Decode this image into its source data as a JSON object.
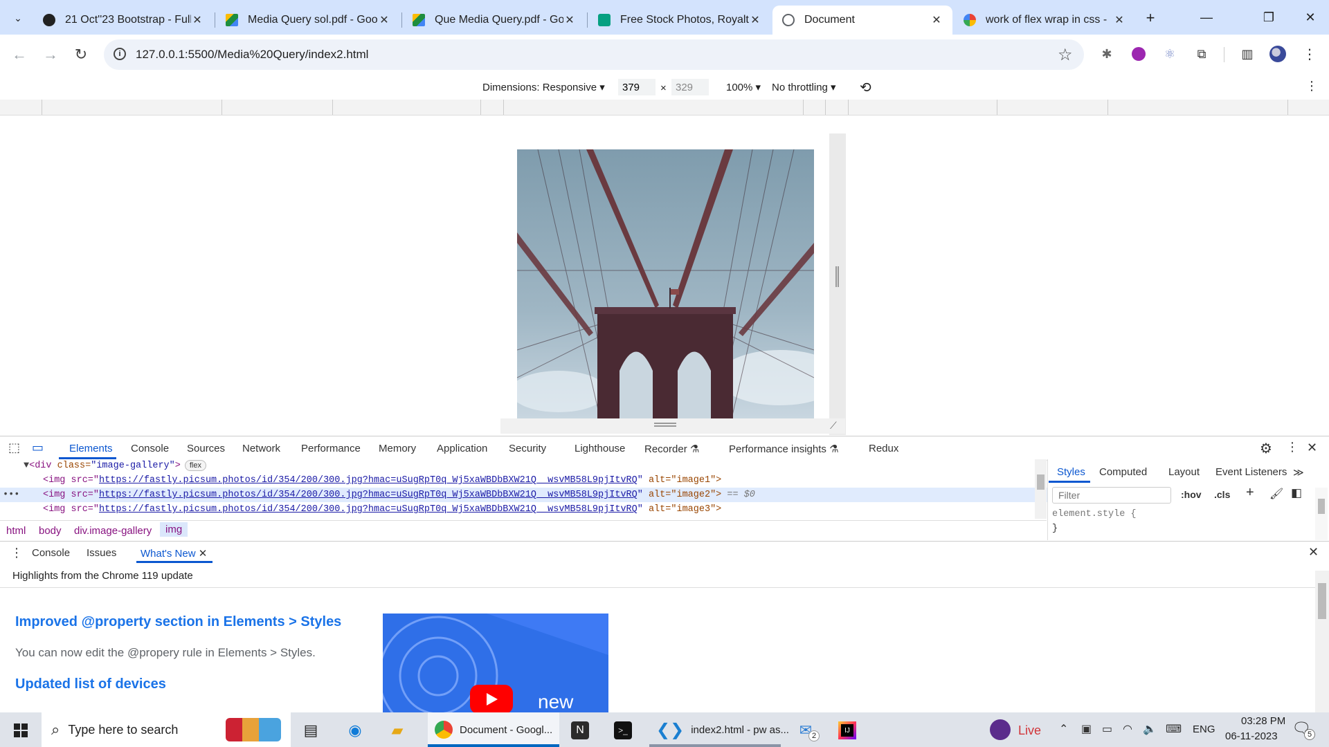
{
  "browser": {
    "tabs": [
      {
        "title": "21 Oct''23 Bootstrap - Full",
        "icon": "github-icon",
        "color": "#222222"
      },
      {
        "title": "Media Query sol.pdf - Goo",
        "icon": "google-drive-icon",
        "color": "#1e8e3e"
      },
      {
        "title": "Que Media Query.pdf - Go",
        "icon": "google-drive-icon",
        "color": "#1e8e3e"
      },
      {
        "title": "Free Stock Photos, Royalty",
        "icon": "pexels-icon",
        "color": "#05a081"
      },
      {
        "title": "Document",
        "icon": "globe-icon",
        "color": "#5f6368",
        "active": true
      },
      {
        "title": "work of flex wrap in css -",
        "icon": "google-icon",
        "color": "#4285f4"
      }
    ],
    "new_tab": "+",
    "url": "127.0.0.1:5500/Media%20Query/index2.html"
  },
  "device_toolbar": {
    "dimensions_label": "Dimensions: Responsive",
    "width": "379",
    "times": "×",
    "height": "329",
    "zoom": "100%",
    "throttling": "No throttling"
  },
  "devtools": {
    "tabs": [
      "Elements",
      "Console",
      "Sources",
      "Network",
      "Performance",
      "Memory",
      "Application",
      "Security",
      "Lighthouse",
      "Recorder",
      "Performance insights",
      "Redux"
    ],
    "dom": {
      "parent_tag_open": "<div",
      "parent_attr": "class=",
      "parent_val": "\"image-gallery\"",
      "parent_close": ">",
      "flex_badge": "flex",
      "img_prefix": "<img src=\"",
      "img_src": "https://fastly.picsum.photos/id/354/200/300.jpg?hmac=uSugRpT0q_Wj5xaWBDbBXW21Q__wsvMB58L9pjItvRQ",
      "lines": [
        {
          "alt": " alt=\"image1\">"
        },
        {
          "alt": " alt=\"image2\">",
          "suffix": " == $0"
        },
        {
          "alt": " alt=\"image3\">"
        }
      ],
      "ellipsis": "•••"
    },
    "breadcrumbs": [
      "html",
      "body",
      "div.image-gallery",
      "img"
    ],
    "styles_tabs": [
      "Styles",
      "Computed",
      "Layout",
      "Event Listeners",
      "≫"
    ],
    "filter_placeholder": "Filter",
    "hov": ":hov",
    "cls": ".cls",
    "element_style": "element.style {",
    "close_brace": "}",
    "drawer_tabs": [
      "Console",
      "Issues",
      "What's New"
    ],
    "whats_new_header": "Highlights from the Chrome 119 update",
    "whats_new": {
      "heading1": "Improved @property section in Elements > Styles",
      "text1": "You can now edit the @propery rule in Elements > Styles.",
      "heading2": "Updated list of devices",
      "video_label": "new"
    }
  },
  "taskbar": {
    "search_placeholder": "Type here to search",
    "apps": [
      {
        "label": "Document - Googl..."
      },
      {
        "label": "index2.html - pw as..."
      }
    ],
    "mail_badge": "2",
    "live": "Live",
    "lang": "ENG",
    "time": "03:28 PM",
    "date": "06-11-2023",
    "notif_count": "5"
  }
}
